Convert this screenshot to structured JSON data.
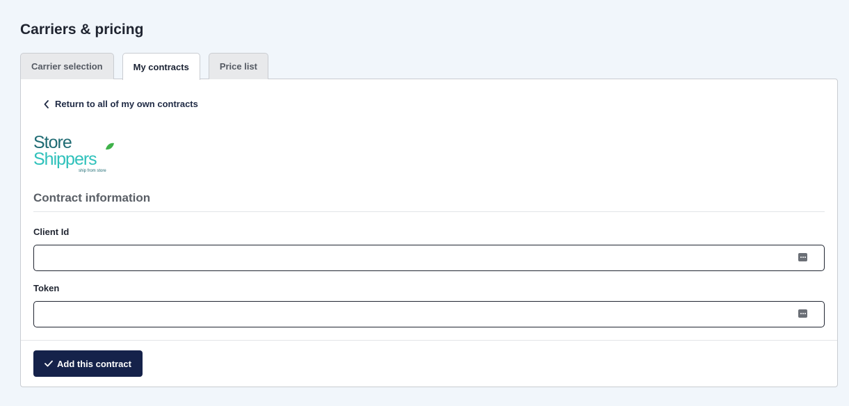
{
  "page": {
    "title": "Carriers & pricing"
  },
  "tabs": [
    {
      "label": "Carrier selection",
      "active": false
    },
    {
      "label": "My contracts",
      "active": true
    },
    {
      "label": "Price list",
      "active": false
    }
  ],
  "back_link": {
    "label": "Return to all of my own contracts",
    "icon": "chevron-left-icon"
  },
  "logo": {
    "line1": "Store",
    "line2": "Shippers",
    "tagline": "ship from store",
    "colors": {
      "dark": "#1f6b73",
      "light": "#2fc1bb"
    }
  },
  "section": {
    "title": "Contract information"
  },
  "fields": {
    "client_id": {
      "label": "Client Id",
      "value": "",
      "icon": "password-manager-icon"
    },
    "token": {
      "label": "Token",
      "value": "",
      "icon": "password-manager-icon"
    }
  },
  "actions": {
    "submit_label": "Add this contract",
    "submit_icon": "check-icon"
  },
  "colors": {
    "primary": "#15224a",
    "background": "#f1f6fb"
  }
}
